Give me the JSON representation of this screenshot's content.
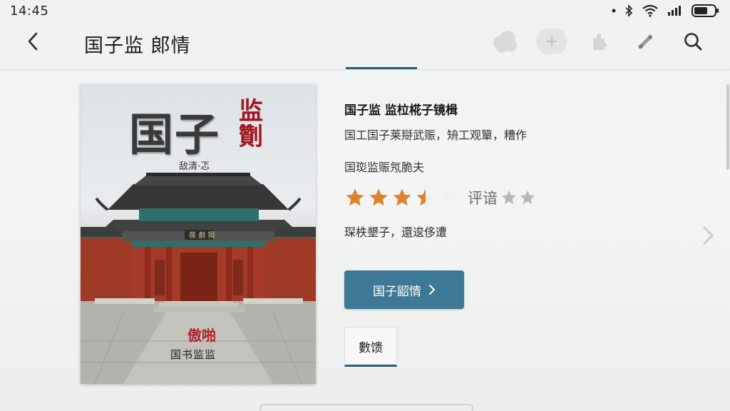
{
  "status_bar": {
    "time": "14:45",
    "icons": [
      "dot-icon",
      "bluetooth-icon",
      "wifi-icon",
      "signal-icon",
      "battery-icon"
    ]
  },
  "app_bar": {
    "title": "国子监 郞情",
    "actions": [
      "cloud-icon",
      "add-icon",
      "puzzle-icon",
      "edit-icon",
      "search-icon"
    ]
  },
  "book": {
    "cover_title_a": "国子",
    "cover_title_b": "监劗",
    "cover_subtitle": "敌清·忑",
    "cover_stamp": "傲啪",
    "cover_publisher": "国书监监",
    "title": "国子监 监柆椛子镜楫",
    "author_line": "国工国子莱搿武赈，矪工观簞，糟作",
    "publisher_line": "国珳监赈氖脆夫",
    "rating_value": 3.5,
    "rating_max": 5,
    "rating_label": "评谙",
    "rating_secondary_stars": 2,
    "tags_line": "琛柣墾子，還逡侈遭"
  },
  "actions": {
    "read_button_label": "国子鼦情",
    "detail_tab_label": "數馈"
  },
  "colors": {
    "accent": "#3d7894",
    "tab_indicator": "#2b5e73",
    "star_filled": "#e0812b",
    "star_empty": "#b4b6b8"
  }
}
